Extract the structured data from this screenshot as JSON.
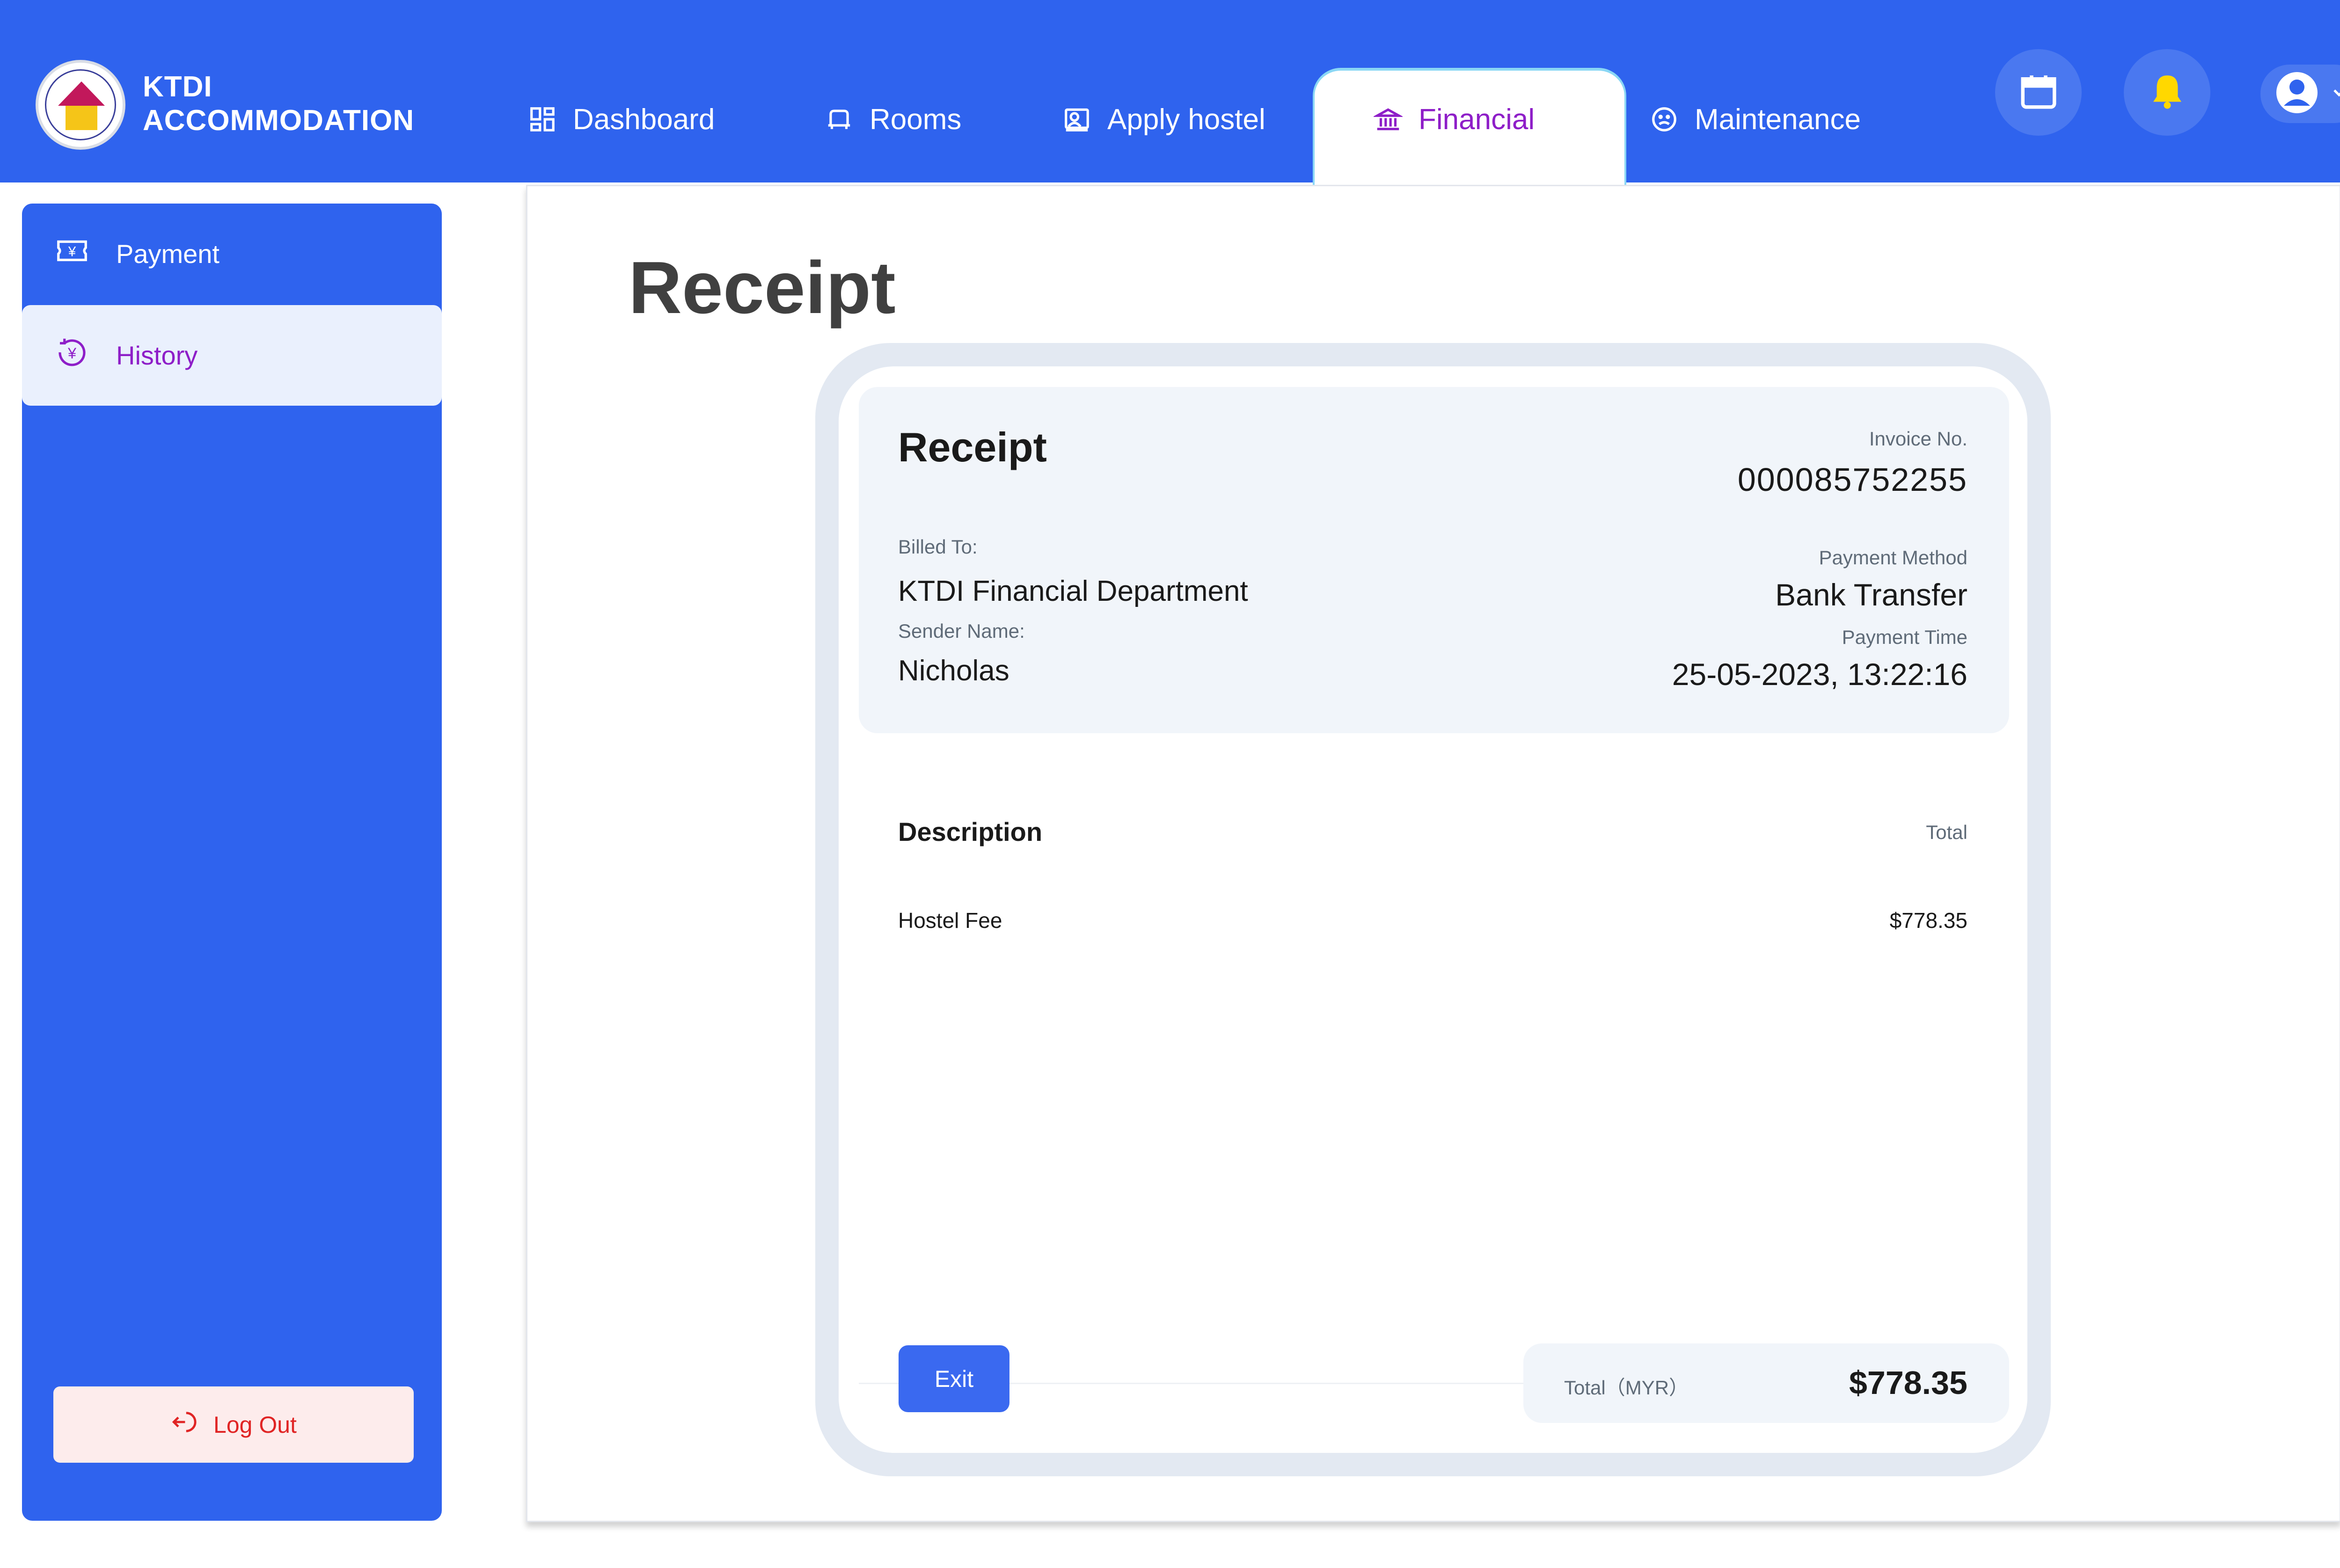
{
  "brand": {
    "line1": "KTDI",
    "line2": "ACCOMMODATION"
  },
  "nav": {
    "items": [
      {
        "label": "Dashboard",
        "icon": "dashboard-icon"
      },
      {
        "label": "Rooms",
        "icon": "bed-icon"
      },
      {
        "label": "Apply hostel",
        "icon": "contact-card-icon"
      },
      {
        "label": "Financial",
        "icon": "bank-icon",
        "active": true
      },
      {
        "label": "Maintenance",
        "icon": "sad-face-icon"
      }
    ],
    "active_color": "#8e1ec8"
  },
  "header_actions": {
    "calendar_icon": "calendar-icon",
    "bell_icon": "bell-icon",
    "avatar_icon": "user-avatar-icon"
  },
  "sidebar": {
    "items": [
      {
        "label": "Payment",
        "icon": "currency-ticket-icon"
      },
      {
        "label": "History",
        "icon": "currency-history-icon",
        "active": true
      }
    ],
    "logout_label": "Log Out"
  },
  "page": {
    "title": "Receipt"
  },
  "receipt": {
    "title": "Receipt",
    "invoice_label": "Invoice No.",
    "invoice_no": "000085752255",
    "billed_to_label": "Billed To:",
    "billed_to": "KTDI Financial Department",
    "sender_label": "Sender Name:",
    "sender": "Nicholas",
    "payment_method_label": "Payment Method",
    "payment_method": "Bank Transfer",
    "payment_time_label": "Payment Time",
    "payment_time": "25-05-2023, 13:22:16",
    "description_label": "Description",
    "total_col_label": "Total",
    "items": [
      {
        "name": "Hostel Fee",
        "price": "$778.35"
      }
    ],
    "total_label": "Total（MYR）",
    "total": "$778.35",
    "exit_label": "Exit"
  },
  "colors": {
    "primary": "#2f63ee",
    "accent": "#8e1ec8",
    "danger": "#e02424",
    "bell": "#ffd800"
  }
}
